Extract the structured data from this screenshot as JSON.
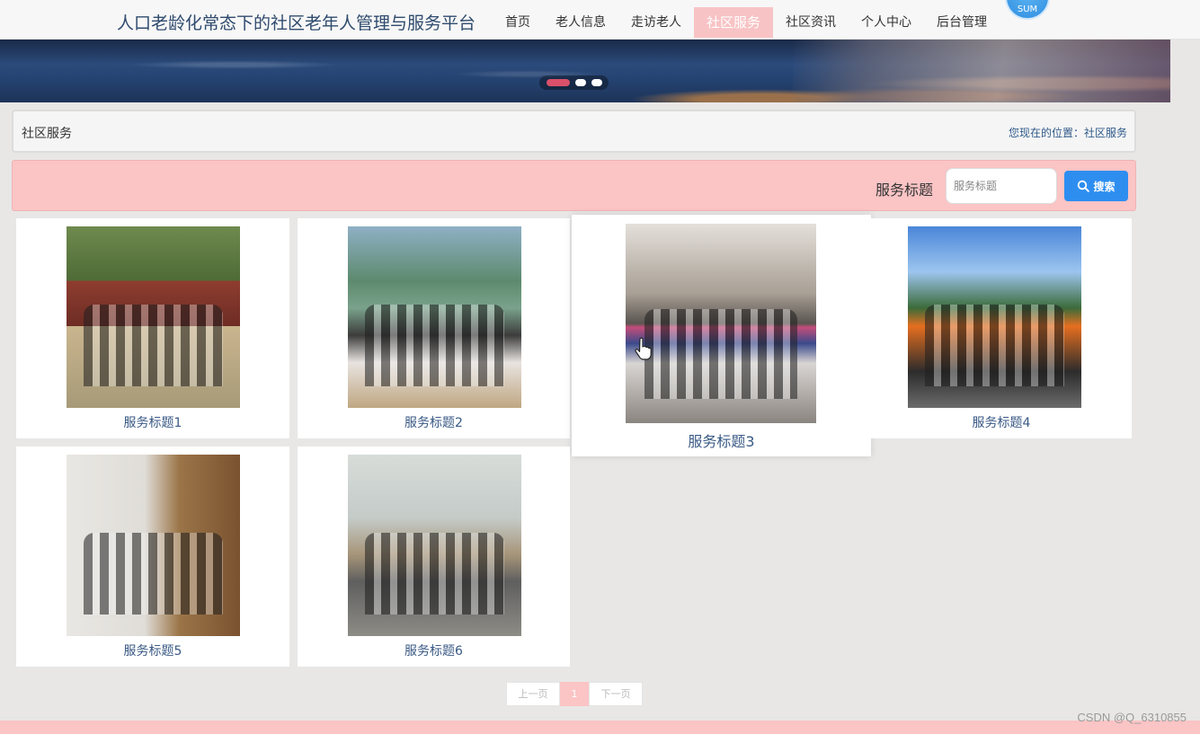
{
  "site": {
    "title": "人口老龄化常态下的社区老年人管理与服务平台"
  },
  "nav": {
    "items": [
      {
        "label": "首页"
      },
      {
        "label": "老人信息"
      },
      {
        "label": "走访老人"
      },
      {
        "label": "社区服务",
        "active": true
      },
      {
        "label": "社区资讯"
      },
      {
        "label": "个人中心"
      },
      {
        "label": "后台管理"
      }
    ],
    "avatar_text": "SUM"
  },
  "banner": {
    "slides_count": 3,
    "active_slide": 1
  },
  "breadcrumb": {
    "page_title": "社区服务",
    "location_prefix": "您现在的位置：",
    "location_current": "社区服务"
  },
  "search": {
    "label": "服务标题",
    "placeholder": "服务标题",
    "value": "",
    "button_label": "搜索",
    "button_icon": "search-icon"
  },
  "services": [
    {
      "title": "服务标题1"
    },
    {
      "title": "服务标题2"
    },
    {
      "title": "服务标题3"
    },
    {
      "title": "服务标题4"
    },
    {
      "title": "服务标题5"
    },
    {
      "title": "服务标题6"
    }
  ],
  "pagination": {
    "prev_label": "上一页",
    "current_page": "1",
    "next_label": "下一页"
  },
  "watermark": "CSDN @Q_6310855",
  "colors": {
    "accent_pink": "#fbc4c5",
    "primary_blue": "#2e8ef0",
    "title_blue": "#2f4b6e"
  }
}
